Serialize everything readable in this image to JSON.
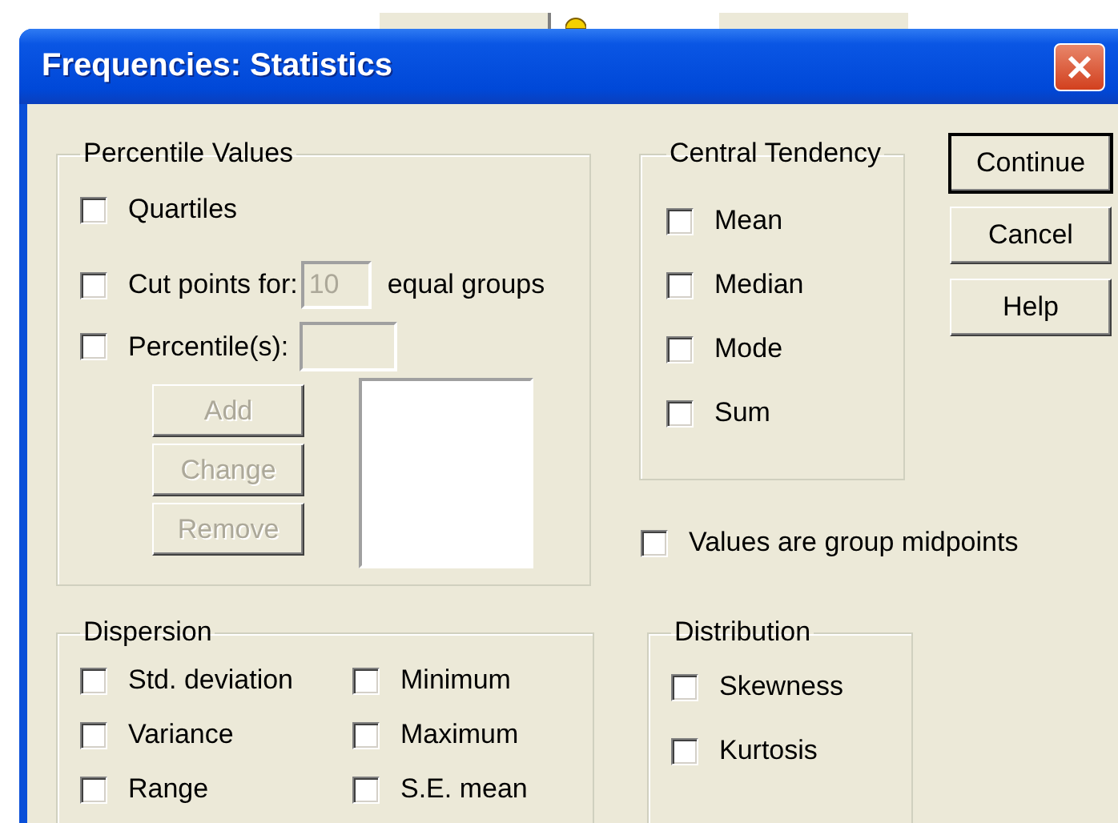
{
  "window": {
    "title": "Frequencies: Statistics"
  },
  "percentile_values": {
    "title": "Percentile Values",
    "quartiles": {
      "label": "Quartiles",
      "checked": false
    },
    "cut_points": {
      "label": "Cut points for:",
      "checked": false,
      "value": "10",
      "disabled": true,
      "suffix": "equal groups"
    },
    "percentiles": {
      "label": "Percentile(s):",
      "checked": false,
      "disabled": true
    },
    "buttons": [
      {
        "label": "Add",
        "disabled": true
      },
      {
        "label": "Change",
        "disabled": true
      },
      {
        "label": "Remove",
        "disabled": true
      }
    ]
  },
  "central_tendency": {
    "title": "Central Tendency",
    "items": [
      {
        "label": "Mean",
        "checked": false
      },
      {
        "label": "Median",
        "checked": false
      },
      {
        "label": "Mode",
        "checked": false
      },
      {
        "label": "Sum",
        "checked": false
      }
    ]
  },
  "group_midpoints": {
    "label": "Values are group midpoints",
    "checked": false
  },
  "buttons": [
    {
      "label": "Continue",
      "default": true
    },
    {
      "label": "Cancel",
      "default": false
    },
    {
      "label": "Help",
      "default": false
    }
  ],
  "dispersion": {
    "title": "Dispersion",
    "items": [
      {
        "label": "Std. deviation",
        "checked": false
      },
      {
        "label": "Minimum",
        "checked": false
      },
      {
        "label": "Variance",
        "checked": false
      },
      {
        "label": "Maximum",
        "checked": false
      },
      {
        "label": "Range",
        "checked": false
      },
      {
        "label": "S.E. mean",
        "checked": false
      }
    ]
  },
  "distribution": {
    "title": "Distribution",
    "items": [
      {
        "label": "Skewness",
        "checked": false
      },
      {
        "label": "Kurtosis",
        "checked": false
      }
    ]
  }
}
